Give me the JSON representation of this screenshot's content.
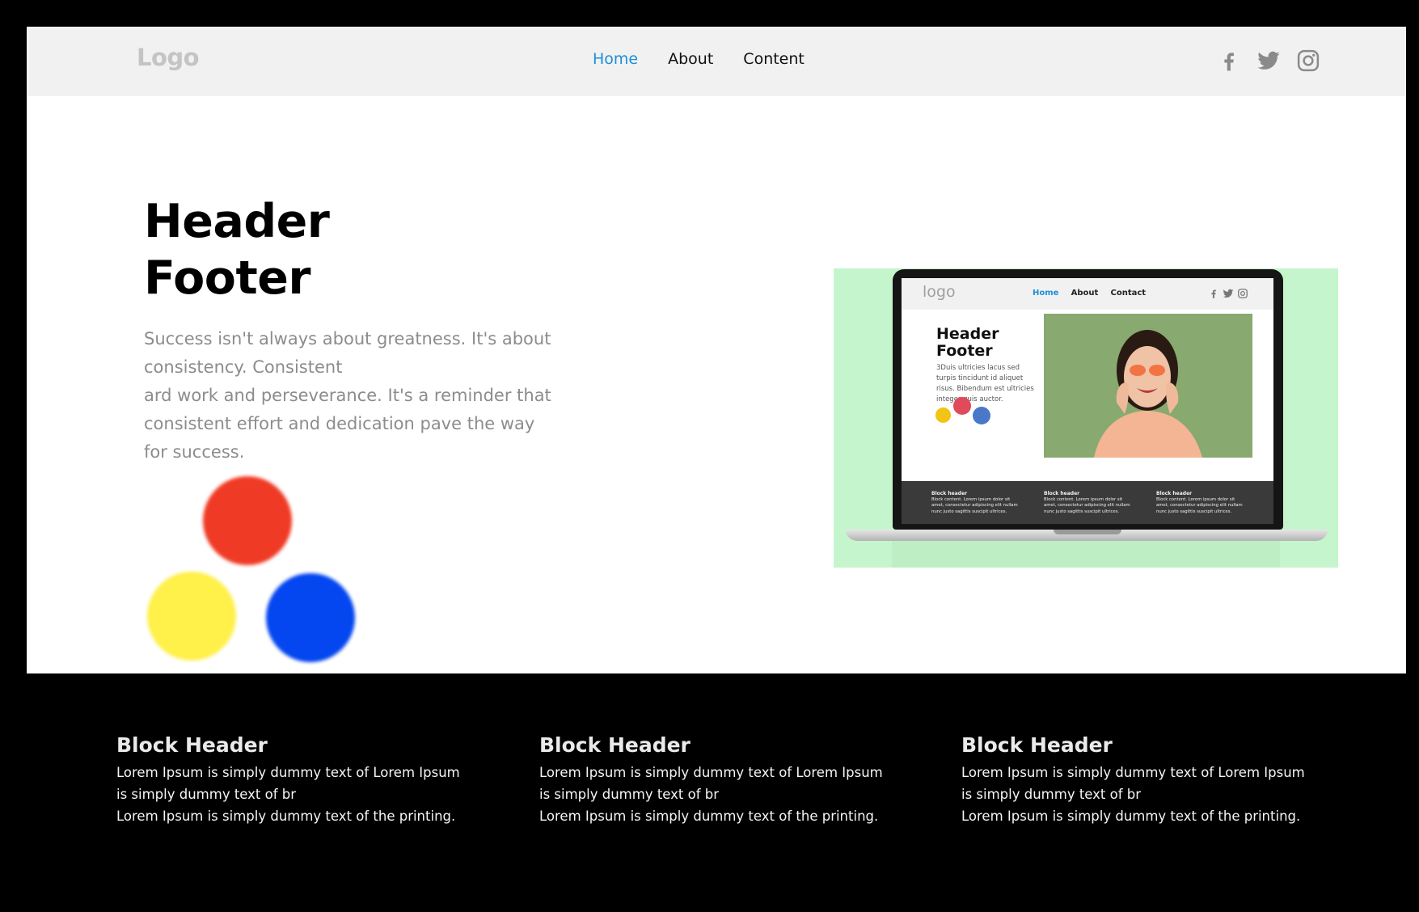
{
  "nav": {
    "logo": "Logo",
    "links": [
      {
        "label": "Home",
        "active": true
      },
      {
        "label": "About",
        "active": false
      },
      {
        "label": "Content",
        "active": false
      }
    ],
    "social_icons": [
      "facebook-icon",
      "twitter-icon",
      "instagram-icon"
    ]
  },
  "hero": {
    "title_line1": "Header",
    "title_line2": "Footer",
    "text_lines": [
      "Success isn't always about greatness. It's about",
      "consistency. Consistent",
      "ard work and perseverance. It's a reminder that",
      "consistent effort and dedication pave the way",
      "for success."
    ],
    "dot_colors": [
      "#ef3b25",
      "#fff04a",
      "#0446ef"
    ]
  },
  "mockup": {
    "background": "#c5f5cc",
    "logo": "logo",
    "links": [
      "Home",
      "About",
      "Contact"
    ],
    "title_line1": "Header",
    "title_line2": "Footer",
    "description": "3Duis ultricies lacus sed turpis tincidunt id aliquet risus. Bibendum est ultricies integer quis auctor.",
    "blocks": [
      {
        "heading": "Block header",
        "text": "Block content. Lorem ipsum dolor sit amet, consectetur adipiscing elit nullam nunc justo sagittis suscipit ultrices."
      },
      {
        "heading": "Block header",
        "text": "Block content. Lorem ipsum dolor sit amet, consectetur adipiscing elit nullam nunc justo sagittis suscipit ultrices."
      },
      {
        "heading": "Block header",
        "text": "Block content. Lorem ipsum dolor sit amet, consectetur adipiscing elit nullam nunc justo sagittis suscipit ultrices."
      }
    ]
  },
  "footer": {
    "blocks": [
      {
        "heading": "Block Header",
        "lines": [
          "Lorem Ipsum is simply dummy text of Lorem Ipsum",
          "is simply dummy text of br",
          "Lorem Ipsum is simply dummy text of the printing."
        ]
      },
      {
        "heading": "Block Header",
        "lines": [
          "Lorem Ipsum is simply dummy text of Lorem Ipsum",
          "is simply dummy text of br",
          "Lorem Ipsum is simply dummy text of the printing."
        ]
      },
      {
        "heading": "Block Header",
        "lines": [
          "Lorem Ipsum is simply dummy text of Lorem Ipsum",
          "is simply dummy text of br",
          "Lorem Ipsum is simply dummy text of the printing."
        ]
      }
    ]
  },
  "colors": {
    "accent": "#1e8ed9",
    "nav_bg": "#f1f1f1",
    "page_bg": "#000000"
  }
}
